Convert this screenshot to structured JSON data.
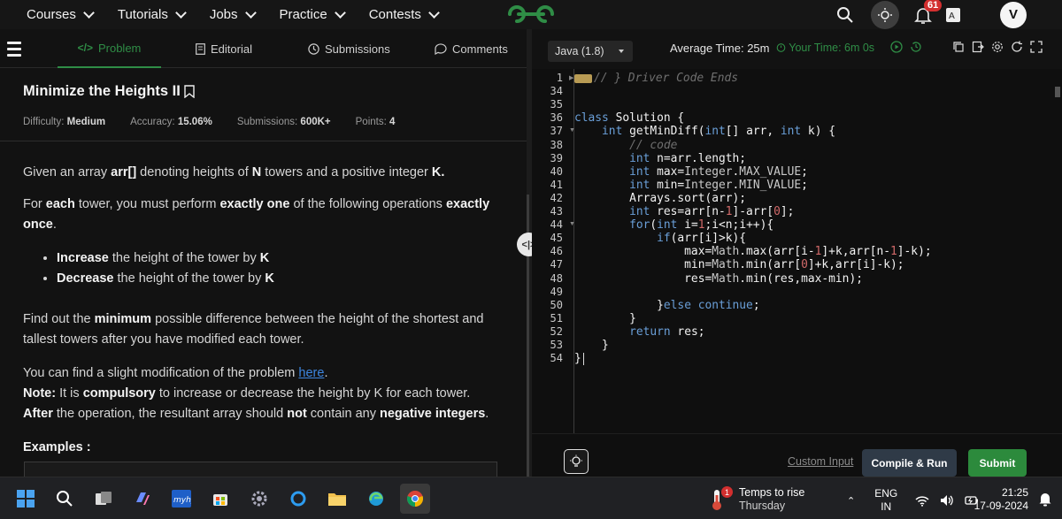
{
  "topnav": {
    "items": [
      "Courses",
      "Tutorials",
      "Jobs",
      "Practice",
      "Contests"
    ],
    "notification_count": "61",
    "avatar_letter": "V"
  },
  "tabs": {
    "problem": "Problem",
    "editorial": "Editorial",
    "submissions": "Submissions",
    "comments": "Comments"
  },
  "problem": {
    "title": "Minimize the Heights II",
    "difficulty_label": "Difficulty:",
    "difficulty": "Medium",
    "accuracy_label": "Accuracy:",
    "accuracy": "15.06%",
    "submissions_label": "Submissions:",
    "submissions": "600K+",
    "points_label": "Points:",
    "points": "4",
    "p1_a": "Given an array ",
    "p1_b": "arr[]",
    "p1_c": " denoting heights of ",
    "p1_d": "N",
    "p1_e": " towers and a positive integer ",
    "p1_f": "K.",
    "p2_a": "For ",
    "p2_b": "each",
    "p2_c": " tower, you must perform ",
    "p2_d": "exactly one",
    "p2_e": " of the following operations ",
    "p2_f": "exactly once",
    "p2_g": ".",
    "b1_a": "Increase",
    "b1_b": " the height of the tower by ",
    "b1_c": "K",
    "b2_a": "Decrease",
    "b2_b": " the height of the tower by ",
    "b2_c": "K",
    "p3_a": "Find out the ",
    "p3_b": "minimum",
    "p3_c": " possible difference between the height of the shortest and tallest towers after you have modified each tower.",
    "p4_a": "You can find a slight modification of the problem ",
    "p4_link": "here",
    "p4_b": ".",
    "p5_a": "Note:",
    "p5_b": " It is ",
    "p5_c": "compulsory",
    "p5_d": " to increase or decrease the height by K for each tower. ",
    "p5_e": "After",
    "p5_f": " the operation, the resultant array should ",
    "p5_g": "not",
    "p5_h": " contain any ",
    "p5_i": "negative integers",
    "p5_j": ".",
    "examples": "Examples :"
  },
  "editor": {
    "language": "Java (1.8)",
    "average_time": "Average Time: 25m",
    "your_time": "Your Time: 6m 0s",
    "line_numbers": [
      "1",
      "34",
      "35",
      "36",
      "37",
      "38",
      "39",
      "40",
      "41",
      "42",
      "43",
      "44",
      "45",
      "46",
      "47",
      "48",
      "49",
      "50",
      "51",
      "52",
      "53",
      "54"
    ],
    "code_lines": [
      "// } Driver Code Ends",
      "",
      "",
      "class Solution {",
      "    int getMinDiff(int[] arr, int k) {",
      "        // code",
      "        int n=arr.length;",
      "        int max=Integer.MAX_VALUE;",
      "        int min=Integer.MIN_VALUE;",
      "        Arrays.sort(arr);",
      "        int res=arr[n-1]-arr[0];",
      "        for(int i=1;i<n;i++){",
      "            if(arr[i]>k){",
      "                max=Math.max(arr[i-1]+k,arr[n-1]-k);",
      "                min=Math.min(arr[0]+k,arr[i]-k);",
      "                res=Math.min(res,max-min);",
      "",
      "            }else continue;",
      "        }",
      "        return res;",
      "    }",
      "}"
    ],
    "custom_input": "Custom Input",
    "compile_run": "Compile & Run",
    "submit": "Submit"
  },
  "taskbar": {
    "weather_title": "Temps to rise",
    "weather_sub": "Thursday",
    "weather_badge": "1",
    "lang_top": "ENG",
    "lang_bottom": "IN",
    "time": "21:25",
    "date": "17-09-2024"
  },
  "colors": {
    "brand_green": "#2f8d46",
    "link_blue": "#3d86e0",
    "keyword_blue": "#6a9fd8",
    "number_red": "#d16969"
  }
}
